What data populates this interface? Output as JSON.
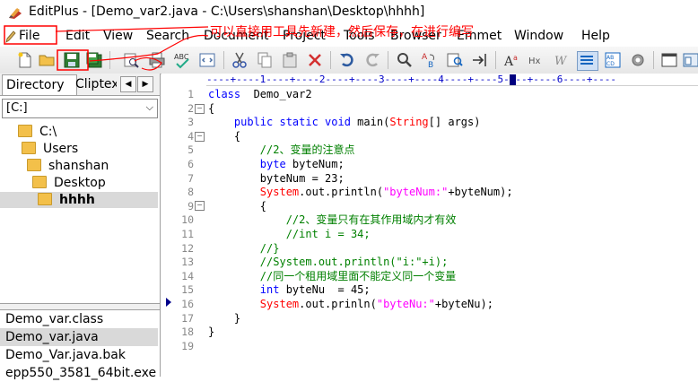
{
  "window": {
    "title": "EditPlus - [Demo_var2.java - C:\\Users\\shanshan\\Desktop\\hhhh]"
  },
  "menu": [
    "File",
    "Edit",
    "View",
    "Search",
    "Document",
    "Project",
    "Tools",
    "Browser",
    "Emmet",
    "Window",
    "Help"
  ],
  "toolbar": {
    "icons": [
      "new-file-icon",
      "open-folder-icon",
      "save-icon",
      "save-all-icon",
      "print-preview-icon",
      "print-icon",
      "spell-check-icon",
      "browser-preview-icon",
      "cut-icon",
      "copy-icon",
      "paste-icon",
      "delete-icon",
      "undo-icon",
      "redo-icon",
      "find-icon",
      "replace-icon",
      "find-in-files-icon",
      "goto-icon",
      "font-icon",
      "hex-icon",
      "word-wrap-icon",
      "line-numbers-icon",
      "column-select-icon",
      "preferences-icon",
      "window-icon",
      "window2-icon"
    ]
  },
  "sidebar": {
    "tabs": [
      "Directory",
      "Cliptext"
    ],
    "drive": "[C:]",
    "tree": [
      "C:\\",
      "Users",
      "shanshan",
      "Desktop",
      "hhhh"
    ],
    "files": [
      "Demo_var.class",
      "Demo_var.java",
      "Demo_Var.java.bak",
      "epp550_3581_64bit.exe"
    ]
  },
  "editor": {
    "ruler": "----+----1----+----2----+----3----+----4----+----5----+----6----+----",
    "line_numbers": [
      "1",
      "2",
      "3",
      "4",
      "5",
      "6",
      "7",
      "8",
      "9",
      "10",
      "11",
      "12",
      "13",
      "14",
      "15",
      "16",
      "17",
      "18",
      "19"
    ],
    "lines": [
      [
        {
          "t": "class",
          "c": "kw"
        },
        {
          "t": "  Demo_var2",
          "c": ""
        }
      ],
      [
        {
          "t": "{",
          "c": ""
        }
      ],
      [
        {
          "t": "    ",
          "c": ""
        },
        {
          "t": "public static void",
          "c": "kw"
        },
        {
          "t": " main(",
          "c": ""
        },
        {
          "t": "String",
          "c": "cls"
        },
        {
          "t": "[] args)",
          "c": ""
        }
      ],
      [
        {
          "t": "    {",
          "c": ""
        }
      ],
      [
        {
          "t": "        //2、变量的注意点",
          "c": "cmt"
        }
      ],
      [
        {
          "t": "        ",
          "c": ""
        },
        {
          "t": "byte",
          "c": "kw"
        },
        {
          "t": " byteNum;",
          "c": ""
        }
      ],
      [
        {
          "t": "        byteNum = 23;",
          "c": ""
        }
      ],
      [
        {
          "t": "        ",
          "c": ""
        },
        {
          "t": "System",
          "c": "cls"
        },
        {
          "t": ".out.println(",
          "c": ""
        },
        {
          "t": "\"byteNum:\"",
          "c": "str"
        },
        {
          "t": "+byteNum);",
          "c": ""
        }
      ],
      [
        {
          "t": "        {",
          "c": ""
        }
      ],
      [
        {
          "t": "            //2、变量只有在其作用域内才有效",
          "c": "cmt"
        }
      ],
      [
        {
          "t": "            //int i = 34;",
          "c": "cmt"
        }
      ],
      [
        {
          "t": "        //}",
          "c": "cmt"
        }
      ],
      [
        {
          "t": "        //System.out.println(\"i:\"+i);",
          "c": "cmt"
        }
      ],
      [
        {
          "t": "        //同一个租用域里面不能定义同一个变量",
          "c": "cmt"
        }
      ],
      [
        {
          "t": "        ",
          "c": ""
        },
        {
          "t": "int",
          "c": "kw"
        },
        {
          "t": " byteNu  = 45;",
          "c": ""
        }
      ],
      [
        {
          "t": "        ",
          "c": ""
        },
        {
          "t": "System",
          "c": "cls"
        },
        {
          "t": ".out.prinln(",
          "c": ""
        },
        {
          "t": "\"byteNu:\"",
          "c": "str"
        },
        {
          "t": "+byteNu);",
          "c": ""
        }
      ],
      [
        {
          "t": "    }",
          "c": ""
        }
      ],
      [
        {
          "t": "}",
          "c": ""
        }
      ],
      [
        {
          "t": "",
          "c": ""
        }
      ]
    ]
  },
  "annotation": {
    "text": "可以直接用工具先新建，然后保存，在进行编写",
    "color": "#ff0000"
  }
}
